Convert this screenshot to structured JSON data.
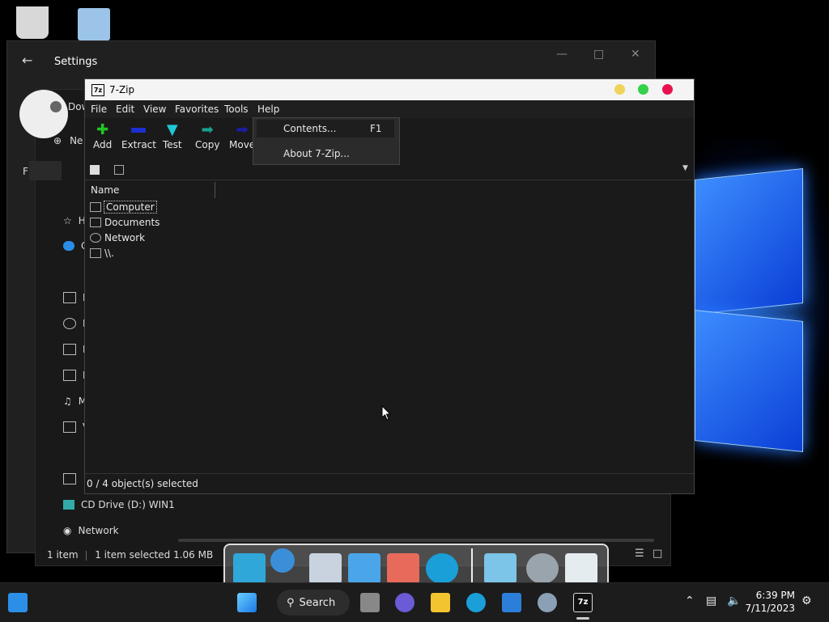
{
  "settings": {
    "title": "Settings",
    "download_label": "Dow",
    "new_label": "Ne",
    "filter_label": "F",
    "side_items": [
      "H",
      "C",
      "D",
      "D",
      "D",
      "P",
      "M",
      "V"
    ],
    "cd_drive": "CD Drive (D:) WIN1",
    "network": "Network",
    "status_items": "1 item",
    "status_selected": "1 item selected  1.06 MB",
    "desktop_label": "F"
  },
  "zip": {
    "title": "7-Zip",
    "logo": "7z",
    "menu": [
      "File",
      "Edit",
      "View",
      "Favorites",
      "Tools",
      "Help"
    ],
    "toolbar": [
      {
        "label": "Add",
        "icon": "plus-icon",
        "color": "#22c722"
      },
      {
        "label": "Extract",
        "icon": "minus-icon",
        "color": "#1c2fd0"
      },
      {
        "label": "Test",
        "icon": "check-icon",
        "color": "#1fc6d6"
      },
      {
        "label": "Copy",
        "icon": "copy-arrow-icon",
        "color": "#1aa090"
      },
      {
        "label": "Move",
        "icon": "move-arrow-icon",
        "color": "#1a1fa8"
      }
    ],
    "column_name": "Name",
    "rows": [
      {
        "label": "Computer",
        "icon": "computer-icon"
      },
      {
        "label": "Documents",
        "icon": "documents-icon"
      },
      {
        "label": "Network",
        "icon": "network-icon"
      },
      {
        "label": "\\\\.",
        "icon": "computer-icon"
      }
    ],
    "status": "0 / 4 object(s) selected",
    "help_menu": [
      {
        "label": "Contents...",
        "shortcut": "F1"
      },
      {
        "label": "About 7-Zip...",
        "shortcut": ""
      }
    ],
    "title_buttons": [
      "#f0c419",
      "#33d04a",
      "#e8134e"
    ]
  },
  "taskbar": {
    "search_label": "Search",
    "time": "6:39 PM",
    "date": "7/11/2023"
  }
}
